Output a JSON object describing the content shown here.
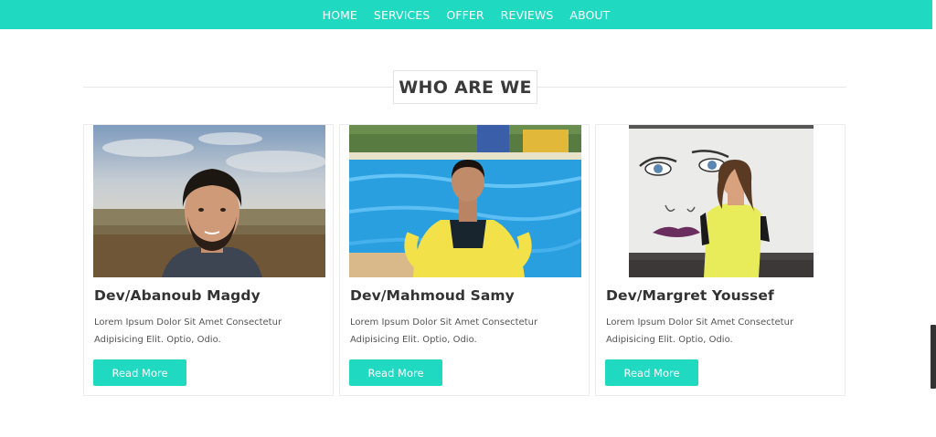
{
  "nav": {
    "items": [
      {
        "label": "HOME"
      },
      {
        "label": "SERVICES"
      },
      {
        "label": "OFFER"
      },
      {
        "label": "REVIEWS"
      },
      {
        "label": "ABOUT"
      }
    ]
  },
  "section": {
    "title": "WHO ARE WE"
  },
  "team": [
    {
      "name": "Dev/Abanoub Magdy",
      "description": "Lorem Ipsum Dolor Sit Amet Consectetur Adipisicing Elit. Optio, Odio.",
      "button_label": "Read More"
    },
    {
      "name": "Dev/Mahmoud Samy",
      "description": "Lorem Ipsum Dolor Sit Amet Consectetur Adipisicing Elit. Optio, Odio.",
      "button_label": "Read More"
    },
    {
      "name": "Dev/Margret Youssef",
      "description": "Lorem Ipsum Dolor Sit Amet Consectetur Adipisicing Elit. Optio, Odio.",
      "button_label": "Read More"
    }
  ],
  "colors": {
    "accent": "#1fd9c1",
    "heading": "#333333",
    "body_text": "#555555"
  }
}
